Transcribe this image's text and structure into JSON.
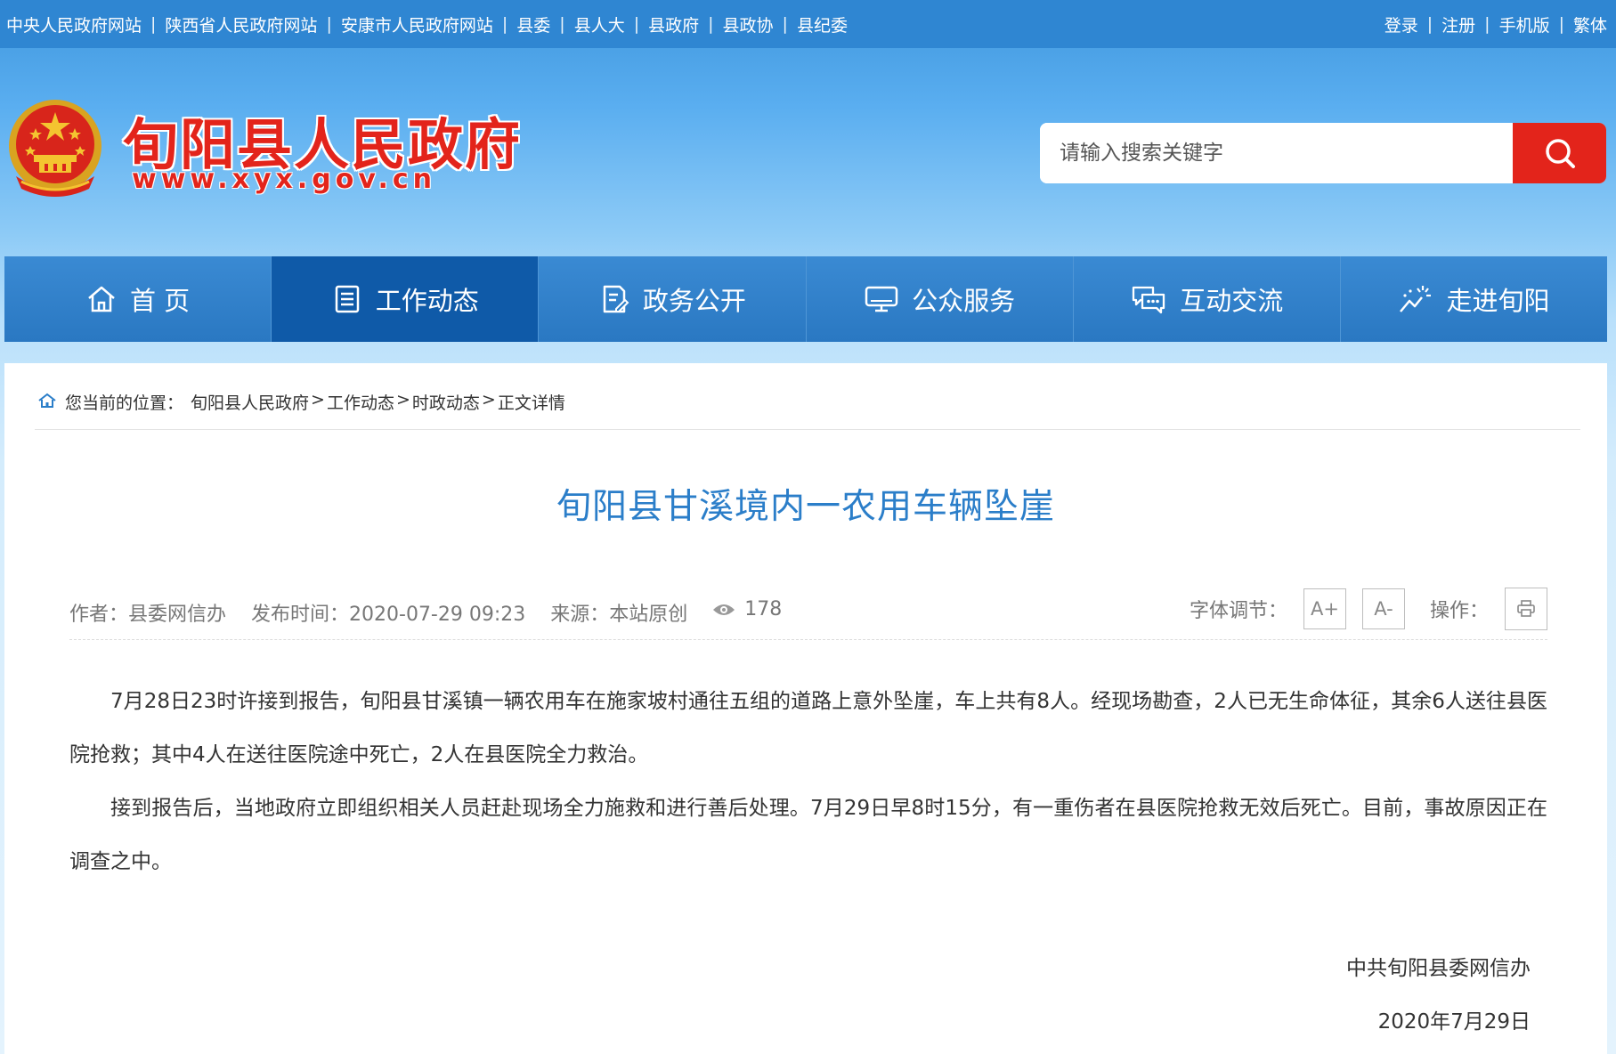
{
  "topbar": {
    "left_links": [
      "中央人民政府网站",
      "陕西省人民政府网站",
      "安康市人民政府网站",
      "县委",
      "县人大",
      "县政府",
      "县政协",
      "县纪委"
    ],
    "right_links": [
      "登录",
      "注册",
      "手机版",
      "繁体"
    ],
    "separator": "|"
  },
  "header": {
    "title": "旬阳县人民政府",
    "url": "www.xyx.gov.cn",
    "emblem_icon": "national-emblem-icon",
    "brand_color": "#e3241b"
  },
  "search": {
    "placeholder": "请输入搜索关键字",
    "button_icon": "search-icon"
  },
  "nav": {
    "items": [
      {
        "label": "首 页",
        "icon": "home-icon"
      },
      {
        "label": "工作动态",
        "icon": "document-list-icon",
        "active": true
      },
      {
        "label": "政务公开",
        "icon": "file-edit-icon"
      },
      {
        "label": "公众服务",
        "icon": "monitor-icon"
      },
      {
        "label": "互动交流",
        "icon": "chat-bubble-icon"
      },
      {
        "label": "走进旬阳",
        "icon": "sparkle-icon"
      }
    ]
  },
  "breadcrumb": {
    "prefix": "您当前的位置：",
    "items": [
      "旬阳县人民政府",
      "工作动态",
      "时政动态",
      "正文详情"
    ],
    "separator": ">"
  },
  "article": {
    "title": "旬阳县甘溪境内一农用车辆坠崖",
    "meta": {
      "author": "作者：县委网信办",
      "published": "发布时间：2020-07-29 09:23",
      "source": "来源：本站原创",
      "views": "178"
    },
    "font_adjust_label": "字体调节：",
    "font_increase": "A+",
    "font_decrease": "A-",
    "operation_label": "操作：",
    "paragraphs": [
      "7月28日23时许接到报告，旬阳县甘溪镇一辆农用车在施家坡村通往五组的道路上意外坠崖，车上共有8人。经现场勘查，2人已无生命体征，其余6人送往县医院抢救；其中4人在送往医院途中死亡，2人在县医院全力救治。",
      "接到报告后，当地政府立即组织相关人员赶赴现场全力施救和进行善后处理。7月29日早8时15分，有一重伤者在县医院抢救无效后死亡。目前，事故原因正在调查之中。"
    ],
    "signature": "中共旬阳县委网信办",
    "date": "2020年7月29日"
  },
  "colors": {
    "topbar": "#2f86d2",
    "nav": "#2a7cc6",
    "nav_active": "#0f5aa8",
    "title_blue": "#2b7ec9"
  }
}
